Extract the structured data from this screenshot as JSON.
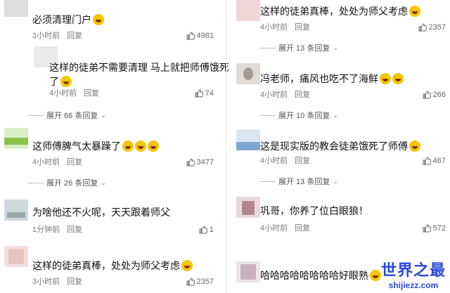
{
  "left": [
    {
      "text": "必须清理门户",
      "emoji": true,
      "time": "3小时前",
      "reply": "回复",
      "likes": "4981"
    },
    {
      "text_lines": [
        "这样的徒弟不需要清理 马上就把师傅饿死",
        "了"
      ],
      "emoji": true,
      "time": "4小时前",
      "reply": "回复",
      "likes": "74",
      "expand": "展开 66 条回复"
    },
    {
      "text": "这师傅脾气太暴躁了",
      "emoji_count": 3,
      "time": "4小时前",
      "reply": "回复",
      "likes": "3477",
      "expand": "展开 26 条回复"
    },
    {
      "text": "为啥他还不火呢，天天跟着师父",
      "time": "1分钟前",
      "reply": "回复",
      "likes": "1"
    },
    {
      "text": "这样的徒弟真棒，处处为师父考虑",
      "emoji": true,
      "time": "3小时前",
      "reply": "回复",
      "likes": "2357"
    }
  ],
  "right": [
    {
      "text": "这样的徒弟真棒，处处为师父考虑",
      "emoji": true,
      "time": "4小时前",
      "reply": "回复",
      "likes": "2357",
      "expand": "展开 13 条回复"
    },
    {
      "text": "冯老师，痛风也吃不了海鲜",
      "emoji_count": 2,
      "time": "4小时前",
      "reply": "回复",
      "likes": "266",
      "expand": "展开 10 条回复"
    },
    {
      "text": "这是现实版的教会徒弟饿死了师傅",
      "emoji": true,
      "time": "4小时前",
      "reply": "回复",
      "likes": "467",
      "expand": "展开 13 条回复"
    },
    {
      "text": "巩哥，你养了位白眼狼！",
      "time": "4小时前",
      "reply": "回复",
      "likes": "572"
    },
    {
      "text": "哈哈哈哈哈哈哈哈好眼熟",
      "emoji": true,
      "time": "",
      "reply": "",
      "likes": ""
    }
  ],
  "watermark": {
    "line1": "世界之最",
    "line2": "shijiezz.com"
  },
  "colors": {
    "watermark": "#2a49d9",
    "meta": "#7a7a7a"
  }
}
